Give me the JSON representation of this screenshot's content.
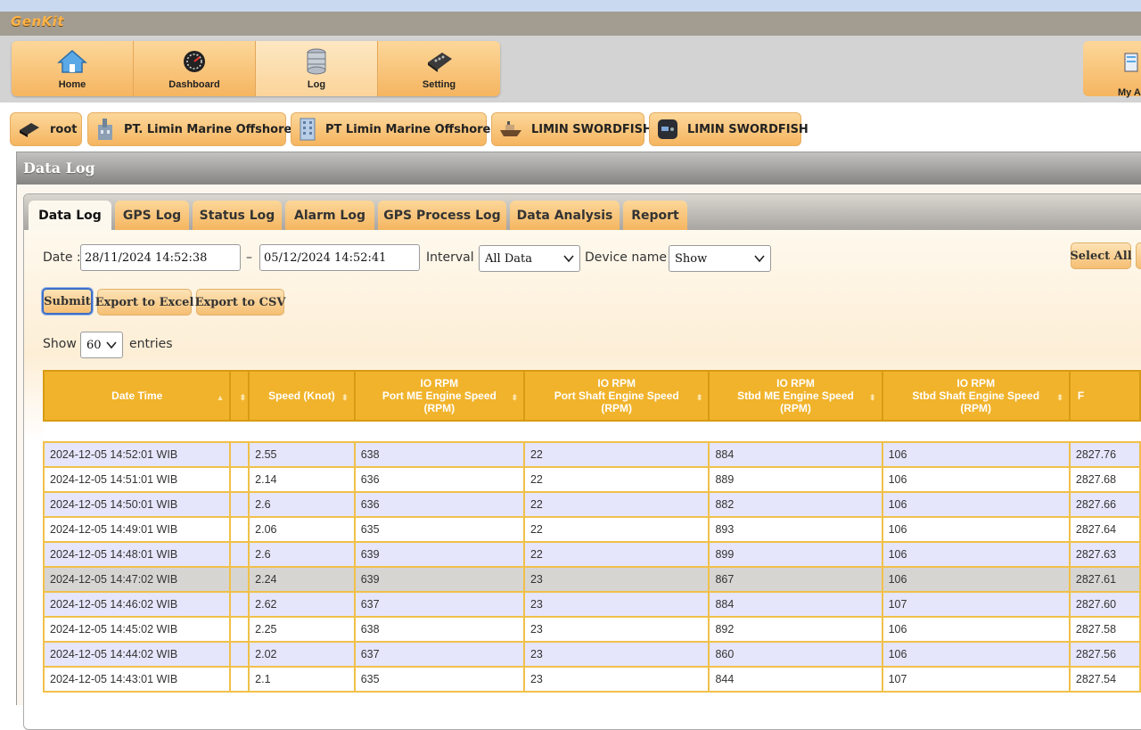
{
  "app": {
    "logo": "GenKit"
  },
  "nav": {
    "items": [
      {
        "label": "Home",
        "icon": "home-icon"
      },
      {
        "label": "Dashboard",
        "icon": "dashboard-icon"
      },
      {
        "label": "Log",
        "icon": "database-icon",
        "active": true
      },
      {
        "label": "Setting",
        "icon": "setting-icon"
      }
    ],
    "account_label": "My Ac"
  },
  "breadcrumb": [
    {
      "label": "root",
      "icon": "router-icon"
    },
    {
      "label": "PT. Limin Marine Offshore",
      "icon": "factory-icon"
    },
    {
      "label": "PT Limin Marine Offshore",
      "icon": "building-icon"
    },
    {
      "label": "LIMIN SWORDFISH",
      "icon": "ship-icon"
    },
    {
      "label": "LIMIN SWORDFISH",
      "icon": "device-icon"
    }
  ],
  "panel": {
    "title": "Data Log"
  },
  "tabs": [
    "Data Log",
    "GPS Log",
    "Status Log",
    "Alarm Log",
    "GPS Process Log",
    "Data Analysis",
    "Report"
  ],
  "filters": {
    "date_label": "Date :",
    "date_from": "28/11/2024 14:52:38",
    "date_sep": "–",
    "date_to": "05/12/2024 14:52:41",
    "interval_label": "Interval :",
    "interval_value": "All Data",
    "device_label": "Device name :",
    "device_value": "Show",
    "select_all": "Select All"
  },
  "actions": {
    "submit": "Submit",
    "export_excel": "Export to Excel",
    "export_csv": "Export to CSV"
  },
  "entries": {
    "show": "Show",
    "value": "60",
    "suffix": "entries"
  },
  "table": {
    "columns": [
      "Date Time",
      "",
      "Speed (Knot)",
      "IO RPM\nPort ME Engine Speed\n(RPM)",
      "IO RPM\nPort Shaft Engine Speed\n(RPM)",
      "IO RPM\nStbd ME Engine Speed\n(RPM)",
      "IO RPM\nStbd Shaft Engine Speed\n(RPM)",
      "F"
    ],
    "rows": [
      [
        "2024-12-05 14:52:01 WIB",
        "",
        "2.55",
        "638",
        "22",
        "884",
        "106",
        "2827.76"
      ],
      [
        "2024-12-05 14:51:01 WIB",
        "",
        "2.14",
        "636",
        "22",
        "889",
        "106",
        "2827.68"
      ],
      [
        "2024-12-05 14:50:01 WIB",
        "",
        "2.6",
        "636",
        "22",
        "882",
        "106",
        "2827.66"
      ],
      [
        "2024-12-05 14:49:01 WIB",
        "",
        "2.06",
        "635",
        "22",
        "893",
        "106",
        "2827.64"
      ],
      [
        "2024-12-05 14:48:01 WIB",
        "",
        "2.6",
        "639",
        "22",
        "899",
        "106",
        "2827.63"
      ],
      [
        "2024-12-05 14:47:02 WIB",
        "",
        "2.24",
        "639",
        "23",
        "867",
        "106",
        "2827.61"
      ],
      [
        "2024-12-05 14:46:02 WIB",
        "",
        "2.62",
        "637",
        "23",
        "884",
        "107",
        "2827.60"
      ],
      [
        "2024-12-05 14:45:02 WIB",
        "",
        "2.25",
        "638",
        "23",
        "892",
        "106",
        "2827.58"
      ],
      [
        "2024-12-05 14:44:02 WIB",
        "",
        "2.02",
        "637",
        "23",
        "860",
        "106",
        "2827.56"
      ],
      [
        "2024-12-05 14:43:01 WIB",
        "",
        "2.1",
        "635",
        "23",
        "844",
        "107",
        "2827.54"
      ]
    ],
    "highlighted_row": 5
  },
  "colors": {
    "accent": "#f5b560",
    "header": "#f1b32b",
    "row_alt": "#e5e6fb",
    "focus": "#3b6ec8"
  }
}
